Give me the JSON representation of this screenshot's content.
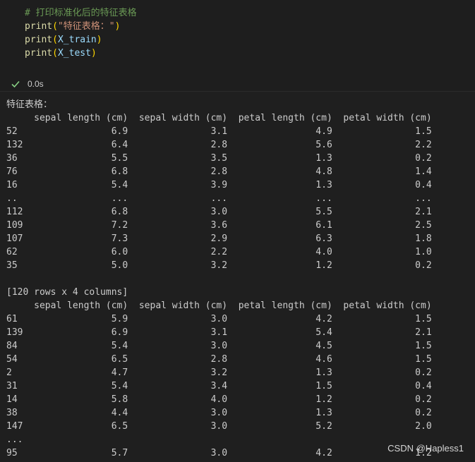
{
  "code_cell": {
    "lines": [
      {
        "comment": "# 打印标准化后的特征表格"
      },
      {
        "fn": "print",
        "arg_str": "\"特征表格：\""
      },
      {
        "fn": "print",
        "arg_var": "X_train"
      },
      {
        "fn": "print",
        "arg_var": "X_test"
      }
    ],
    "run_time": "0.0s",
    "status_icon": "check-icon",
    "status_color": "#89d185"
  },
  "output": {
    "label": "特征表格：",
    "train": {
      "header": "     sepal length (cm)  sepal width (cm)  petal length (cm)  petal width (cm)",
      "rows": [
        "52                 6.9               3.1                4.9               1.5",
        "132                6.4               2.8                5.6               2.2",
        "36                 5.5               3.5                1.3               0.2",
        "76                 6.8               2.8                4.8               1.4",
        "16                 5.4               3.9                1.3               0.4",
        "..                 ...               ...                ...               ...",
        "112                6.8               3.0                5.5               2.1",
        "109                7.2               3.6                6.1               2.5",
        "107                7.3               2.9                6.3               1.8",
        "62                 6.0               2.2                4.0               1.0",
        "35                 5.0               3.2                1.2               0.2"
      ],
      "summary": "[120 rows x 4 columns]"
    },
    "test": {
      "header": "     sepal length (cm)  sepal width (cm)  petal length (cm)  petal width (cm)",
      "rows": [
        "61                 5.9               3.0                4.2               1.5",
        "139                6.9               3.1                5.4               2.1",
        "84                 5.4               3.0                4.5               1.5",
        "54                 6.5               2.8                4.6               1.5",
        "2                  4.7               3.2                1.3               0.2",
        "31                 5.4               3.4                1.5               0.4",
        "14                 5.8               4.0                1.2               0.2",
        "38                 4.4               3.0                1.3               0.2",
        "147                6.5               3.0                5.2               2.0",
        "...",
        "95                 5.7               3.0                4.2               1.2"
      ]
    }
  },
  "watermark": "CSDN @Hapless1",
  "colors": {
    "background": "#1f1f1f",
    "comment": "#6a9955",
    "function": "#dcdcaa",
    "string": "#ce9178",
    "variable": "#9cdcfe",
    "bracket": "#ffd700",
    "output_text": "#cccccc"
  }
}
